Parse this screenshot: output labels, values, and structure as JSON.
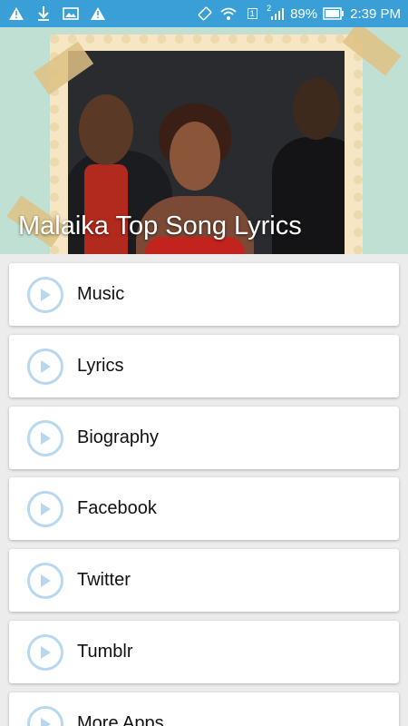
{
  "status_bar": {
    "battery": "89%",
    "time": "2:39 PM",
    "sim_label": "1",
    "signal_label": "2",
    "left_icons": [
      "warning-icon",
      "download-icon",
      "image-icon",
      "warning-icon"
    ],
    "right_icons": [
      "vibrate-icon",
      "wifi-icon",
      "sim-icon",
      "signal-icon",
      "battery-icon"
    ]
  },
  "header": {
    "title": "Malaika Top Song Lyrics"
  },
  "menu": {
    "items": [
      {
        "label": "Music",
        "icon": "play-icon"
      },
      {
        "label": "Lyrics",
        "icon": "play-icon"
      },
      {
        "label": "Biography",
        "icon": "play-icon"
      },
      {
        "label": "Facebook",
        "icon": "play-icon"
      },
      {
        "label": "Twitter",
        "icon": "play-icon"
      },
      {
        "label": "Tumblr",
        "icon": "play-icon"
      },
      {
        "label": "More Apps",
        "icon": "play-icon"
      }
    ]
  },
  "colors": {
    "status_bar": "#3a9fd7",
    "play_icon": "#b7d8ef",
    "background": "#ececec"
  }
}
